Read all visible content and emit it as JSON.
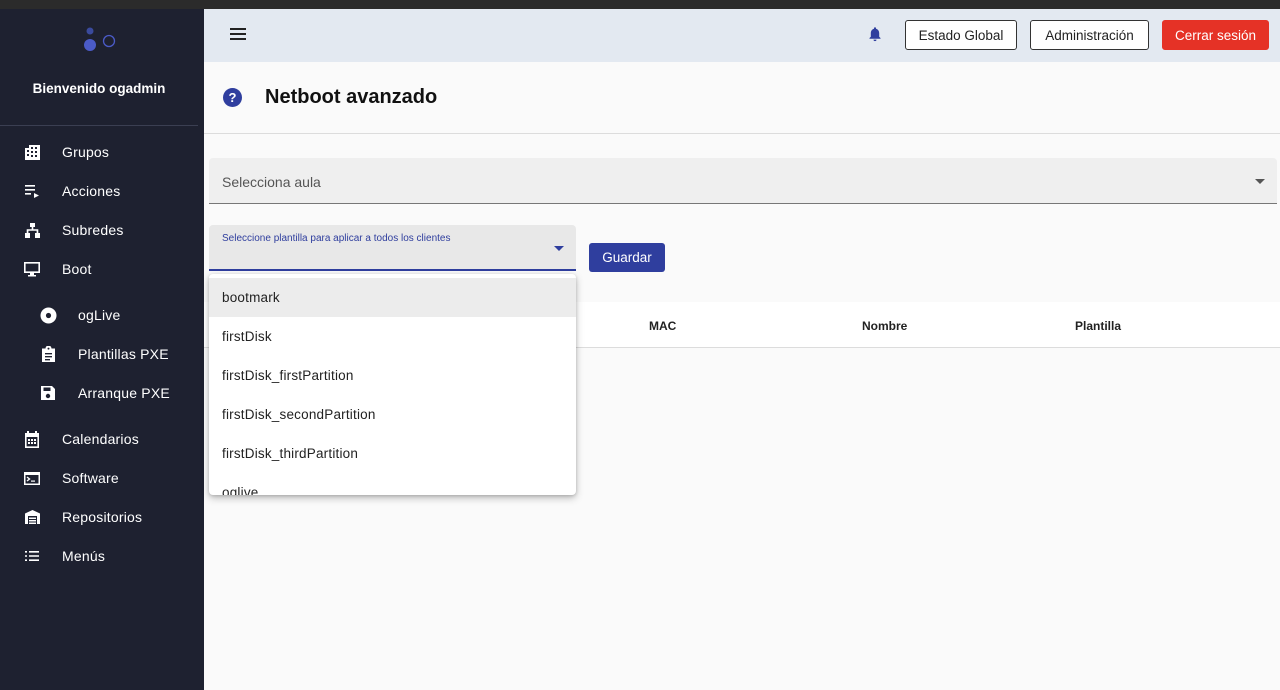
{
  "sidebar": {
    "welcome": "Bienvenido ogadmin",
    "items": [
      {
        "label": "Grupos",
        "icon": "building-icon"
      },
      {
        "label": "Acciones",
        "icon": "playlist-play-icon"
      },
      {
        "label": "Subredes",
        "icon": "sitemap-icon"
      },
      {
        "label": "Boot",
        "icon": "monitor-icon"
      },
      {
        "label": "ogLive",
        "icon": "disc-icon"
      },
      {
        "label": "Plantillas PXE",
        "icon": "clipboard-icon"
      },
      {
        "label": "Arranque PXE",
        "icon": "save-icon"
      },
      {
        "label": "Calendarios",
        "icon": "calendar-icon"
      },
      {
        "label": "Software",
        "icon": "terminal-icon"
      },
      {
        "label": "Repositorios",
        "icon": "warehouse-icon"
      },
      {
        "label": "Menús",
        "icon": "list-icon"
      }
    ]
  },
  "header": {
    "global_state": "Estado Global",
    "admin": "Administración",
    "logout": "Cerrar sesión"
  },
  "page": {
    "title": "Netboot avanzado",
    "classroom_select_placeholder": "Selecciona aula",
    "template_select_label": "Seleccione plantilla para aplicar a todos los clientes",
    "save_button": "Guardar"
  },
  "table": {
    "columns": [
      "MAC",
      "Nombre",
      "Plantilla"
    ]
  },
  "dropdown": {
    "options": [
      "bootmark",
      "firstDisk",
      "firstDisk_firstPartition",
      "firstDisk_secondPartition",
      "firstDisk_thirdPartition",
      "oglive"
    ]
  },
  "colors": {
    "sidebar_bg": "#1e2130",
    "header_bg": "#e3e9f1",
    "primary": "#2f3e9e",
    "danger": "#e53226"
  }
}
